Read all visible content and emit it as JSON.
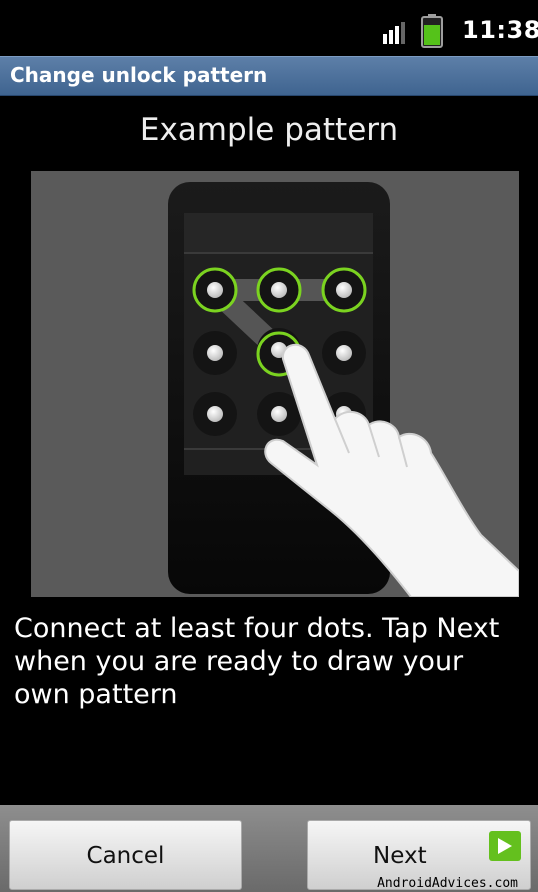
{
  "status_bar": {
    "time": "11:38",
    "signal_icon": "signal-bars-icon",
    "battery_icon": "battery-icon",
    "battery_level": 0.7
  },
  "title_bar": {
    "title": "Change unlock pattern"
  },
  "main": {
    "heading": "Example pattern",
    "illustration": {
      "grid_rows": 3,
      "grid_cols": 3,
      "highlighted_dots": [
        1,
        2,
        3,
        5
      ]
    },
    "instructions": "Connect at least four dots. Tap Next when you are ready to draw your own pattern"
  },
  "buttons": {
    "cancel_label": "Cancel",
    "next_label": "Next",
    "next_icon": "arrow-right-icon"
  },
  "watermark": "AndroidAdvices.com",
  "colors": {
    "title_bar": "#4a6e9a",
    "pattern_highlight": "#7bd320",
    "next_arrow": "#64c01e"
  }
}
